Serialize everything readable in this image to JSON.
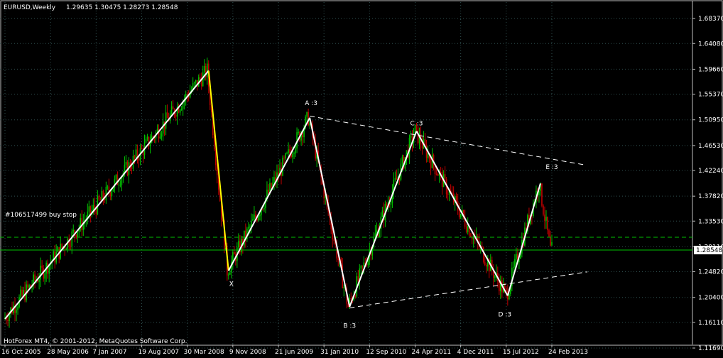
{
  "header": {
    "symbol": "EURUSD,Weekly",
    "ohlc": "1.29635 1.30475 1.28273 1.28548"
  },
  "footer": {
    "copyright": "HotForex MT4, © 2001-2012, MetaQuotes Software Corp."
  },
  "order_label": "#106517499 buy stop",
  "current_price_label": "1.28548",
  "colors": {
    "background": "#000000",
    "grid": "#2f4f4f",
    "up_candle": "#00c000",
    "down_candle": "#c00000",
    "pattern_line": "#ffffff",
    "leg_x_color": "#ffff00",
    "order_line": "#00c000",
    "text": "#ffffff"
  },
  "chart_data": {
    "type": "line",
    "instrument": "EURUSD",
    "timeframe": "Weekly",
    "ylim": [
      1.123,
      1.712
    ],
    "y_ticks": [
      "1.68370",
      "1.64080",
      "1.59660",
      "1.55370",
      "1.50950",
      "1.46530",
      "1.42240",
      "1.37820",
      "1.33530",
      "1.29110",
      "1.24820",
      "1.20400",
      "1.16110",
      "1.11690"
    ],
    "x_ticks": [
      "16 Oct 2005",
      "28 May 2006",
      "7 Jan 2007",
      "19 Aug 2007",
      "30 Mar 2008",
      "9 Nov 2008",
      "21 Jun 2009",
      "31 Jan 2010",
      "12 Sep 2010",
      "24 Apr 2011",
      "4 Dec 2011",
      "15 Jul 2012",
      "24 Feb 2013"
    ],
    "current_price": 1.28548,
    "order_level": 1.3075,
    "pattern_labels": [
      {
        "text": "X",
        "date": "2008-11-02",
        "price": 1.224
      },
      {
        "text": "A :3",
        "date": "2009-11-29",
        "price": 1.535
      },
      {
        "text": "B :3",
        "date": "2010-06-06",
        "price": 1.152
      },
      {
        "text": "C :3",
        "date": "2011-05-01",
        "price": 1.5
      },
      {
        "text": "D :3",
        "date": "2012-07-08",
        "price": 1.171
      },
      {
        "text": "E :3",
        "date": "2013-02-24",
        "price": 1.425
      }
    ],
    "zigzag": [
      {
        "date": "2005-10-16",
        "price": 1.167
      },
      {
        "date": "2008-07-13",
        "price": 1.594
      },
      {
        "date": "2008-10-19",
        "price": 1.25
      },
      {
        "date": "2009-11-22",
        "price": 1.513
      },
      {
        "date": "2010-06-06",
        "price": 1.188
      },
      {
        "date": "2011-05-01",
        "price": 1.49
      },
      {
        "date": "2012-07-22",
        "price": 1.207
      },
      {
        "date": "2012-12-30",
        "price": 1.4
      }
    ],
    "trendlines": [
      {
        "from": {
          "date": "2009-11-22",
          "price": 1.516
        },
        "to": {
          "date": "2013-08-04",
          "price": 1.432
        }
      },
      {
        "from": {
          "date": "2010-06-06",
          "price": 1.186
        },
        "to": {
          "date": "2013-08-18",
          "price": 1.248
        }
      }
    ]
  }
}
